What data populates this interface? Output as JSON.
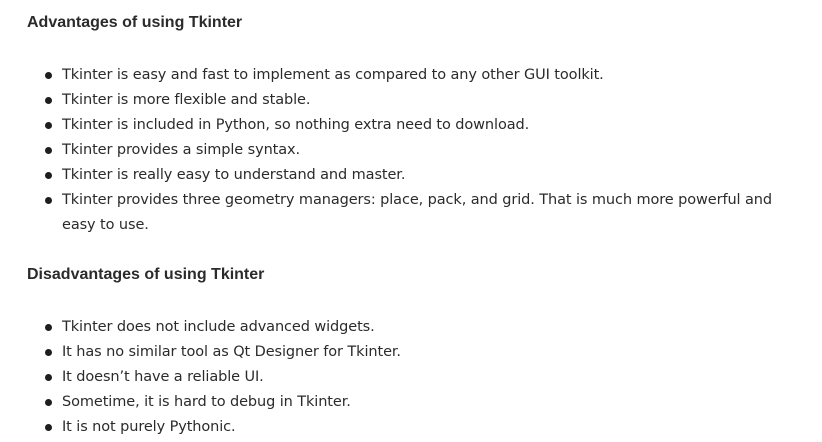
{
  "advantages": {
    "heading": "Advantages of using Tkinter",
    "items": [
      "Tkinter is easy and fast to implement as compared to any other GUI toolkit.",
      "Tkinter is more flexible and stable.",
      "Tkinter is included in Python, so nothing extra need to download.",
      "Tkinter provides a simple syntax.",
      "Tkinter is really easy to understand and master.",
      "Tkinter provides three geometry managers: place, pack, and grid. That is much more powerful and easy to use."
    ]
  },
  "disadvantages": {
    "heading": "Disadvantages of using Tkinter",
    "items": [
      "Tkinter does not include advanced widgets.",
      "It has no similar tool as Qt Designer for Tkinter.",
      "It doesn’t have a reliable UI.",
      "Sometime, it is hard to debug in Tkinter.",
      "It is not purely Pythonic."
    ]
  }
}
